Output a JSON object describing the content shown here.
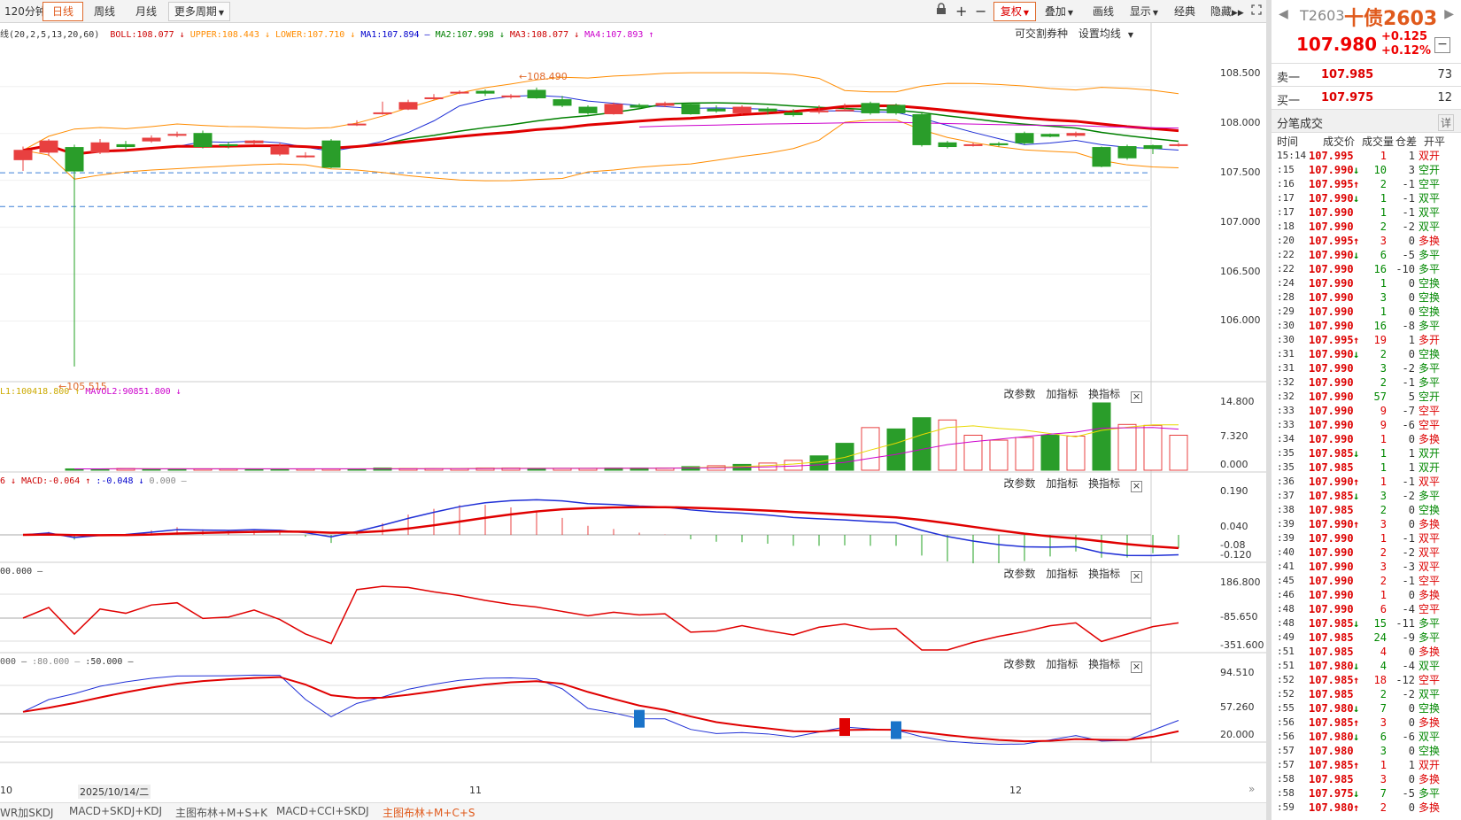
{
  "toolbar": {
    "periods": [
      "120分钟",
      "日线",
      "周线",
      "月线",
      "更多周期"
    ],
    "active_period": "日线",
    "right_buttons": [
      "复权",
      "叠加",
      "画线",
      "显示",
      "经典",
      "隐藏"
    ]
  },
  "legend": {
    "boll": "线(20,2,5,13,20,60)",
    "items": [
      {
        "text": "BOLL:108.077 ↓",
        "color": "#cc0000"
      },
      {
        "text": "UPPER:108.443 ↓",
        "color": "#ff8c00"
      },
      {
        "text": "LOWER:107.710 ↓",
        "color": "#ff8c00"
      },
      {
        "text": "MA1:107.894 —",
        "color": "#0000cc"
      },
      {
        "text": "MA2:107.998 ↓",
        "color": "#008000"
      },
      {
        "text": "MA3:108.077 ↓",
        "color": "#cc0000"
      },
      {
        "text": "MA4:107.893 ↑",
        "color": "#cc00cc"
      }
    ],
    "extra_buttons": [
      "可交割券种",
      "设置均线"
    ]
  },
  "vol_legend": {
    "items": [
      {
        "text": "L1:100418.800 ↑",
        "color": "#ccaa00"
      },
      {
        "text": "MAVOL2:90851.800 ↓",
        "color": "#cc00cc"
      }
    ]
  },
  "macd_legend": {
    "items": [
      {
        "text": "6 ↓",
        "color": "#cc0000"
      },
      {
        "text": "MACD:-0.064 ↑",
        "color": "#cc0000"
      },
      {
        "text": ":-0.048 ↓",
        "color": "#0000cc"
      },
      {
        "text": "0.000 —",
        "color": "#888888"
      }
    ]
  },
  "cci_legend": {
    "items": [
      {
        "text": "00.000 —",
        "color": "#333333"
      }
    ]
  },
  "kdj_legend": {
    "items": [
      {
        "text": "000 —",
        "color": "#555555"
      },
      {
        "text": ":80.000 —",
        "color": "#888888"
      },
      {
        "text": ":50.000 —",
        "color": "#333333"
      }
    ]
  },
  "panel_buttons": [
    "改参数",
    "加指标",
    "换指标"
  ],
  "axes": {
    "price": [
      "108.500",
      "108.000",
      "107.500",
      "107.000",
      "106.500",
      "106.000"
    ],
    "vol": [
      "14.800",
      "7.320",
      "0.000"
    ],
    "macd": [
      "0.190",
      "0.040",
      "-0.08",
      "-0.120"
    ],
    "cci": [
      "186.800",
      "-85.650",
      "-351.600"
    ],
    "kdj": [
      "94.510",
      "57.260",
      "20.000"
    ],
    "dates": [
      {
        "label": "10",
        "x": 0
      },
      {
        "label": "2025/10/14/二",
        "x": 0
      },
      {
        "label": "11",
        "x": 0
      },
      {
        "label": "12",
        "x": 0
      }
    ]
  },
  "annotations": {
    "high": "108.490",
    "low": "105.515"
  },
  "bottom_tabs": [
    "WR加SKDJ",
    "MACD+SKDJ+KDJ",
    "主图布林+M+S+K",
    "MACD+CCI+SKDJ",
    "主图布林+M+C+S"
  ],
  "bottom_active": "主图布林+M+C+S",
  "chart_data": {
    "type": "candlestick",
    "candles": [
      [
        107.72,
        107.82,
        107.86,
        107.6
      ],
      [
        107.8,
        107.92,
        107.94,
        107.76
      ],
      [
        107.85,
        107.6,
        107.88,
        105.515
      ],
      [
        107.8,
        107.9,
        107.94,
        107.78
      ],
      [
        107.88,
        107.86,
        107.92,
        107.82
      ],
      [
        107.92,
        107.95,
        107.98,
        107.9
      ],
      [
        107.98,
        107.99,
        108.02,
        107.96
      ],
      [
        108.0,
        107.86,
        108.03,
        107.84
      ],
      [
        107.88,
        107.87,
        107.91,
        107.84
      ],
      [
        107.9,
        107.92,
        107.93,
        107.88
      ],
      [
        107.78,
        107.86,
        107.9,
        107.76
      ],
      [
        107.76,
        107.76,
        107.8,
        107.74
      ],
      [
        107.92,
        107.64,
        107.94,
        107.63
      ],
      [
        108.1,
        108.1,
        108.14,
        108.08
      ],
      [
        108.22,
        108.22,
        108.34,
        108.2
      ],
      [
        108.26,
        108.33,
        108.36,
        108.25
      ],
      [
        108.38,
        108.38,
        108.42,
        108.36
      ],
      [
        108.44,
        108.44,
        108.46,
        108.42
      ],
      [
        108.45,
        108.43,
        108.47,
        108.4
      ],
      [
        108.39,
        108.4,
        108.42,
        108.37
      ],
      [
        108.46,
        108.38,
        108.49,
        108.37
      ],
      [
        108.36,
        108.3,
        108.4,
        108.28
      ],
      [
        108.28,
        108.22,
        108.3,
        108.2
      ],
      [
        108.21,
        108.31,
        108.33,
        108.2
      ],
      [
        108.3,
        108.28,
        108.32,
        108.26
      ],
      [
        108.3,
        108.32,
        108.34,
        108.28
      ],
      [
        108.31,
        108.21,
        108.33,
        108.2
      ],
      [
        108.26,
        108.24,
        108.3,
        108.22
      ],
      [
        108.22,
        108.28,
        108.3,
        108.2
      ],
      [
        108.26,
        108.24,
        108.28,
        108.2
      ],
      [
        108.22,
        108.2,
        108.26,
        108.18
      ],
      [
        108.24,
        108.24,
        108.3,
        108.21
      ],
      [
        108.25,
        108.25,
        108.32,
        108.24
      ],
      [
        108.32,
        108.22,
        108.34,
        108.2
      ],
      [
        108.3,
        108.22,
        108.32,
        108.2
      ],
      [
        108.2,
        107.88,
        108.22,
        107.86
      ],
      [
        107.9,
        107.86,
        107.92,
        107.84
      ],
      [
        107.88,
        107.88,
        107.9,
        107.86
      ],
      [
        107.89,
        107.88,
        107.91,
        107.86
      ],
      [
        108.0,
        107.9,
        108.02,
        107.88
      ],
      [
        107.99,
        107.97,
        108.0,
        107.96
      ],
      [
        107.98,
        108.0,
        108.02,
        107.96
      ],
      [
        107.85,
        107.65,
        107.86,
        107.64
      ],
      [
        107.86,
        107.74,
        107.88,
        107.72
      ],
      [
        107.87,
        107.84,
        107.88,
        107.78
      ],
      [
        107.88,
        107.88,
        107.9,
        107.86
      ]
    ],
    "volume": [
      0.3,
      0.3,
      0.4,
      0.3,
      0.3,
      0.3,
      0.3,
      0.3,
      0.3,
      0.3,
      0.3,
      0.3,
      0.5,
      0.4,
      0.4,
      0.4,
      0.5,
      0.5,
      0.4,
      0.4,
      0.4,
      0.5,
      0.5,
      0.5,
      0.8,
      1.0,
      1.3,
      1.6,
      2.2,
      3.2,
      6.0,
      9.5,
      9.2,
      11.7,
      11.2,
      7.8,
      6.7,
      7.3,
      7.8,
      7.6,
      15.0,
      10.2,
      10.0,
      7.8
    ],
    "vol_colors": [
      "g",
      "g",
      "r",
      "g",
      "g",
      "r",
      "r",
      "g",
      "g",
      "r",
      "r",
      "g",
      "g",
      "r",
      "r",
      "r",
      "r",
      "r",
      "g",
      "r",
      "r",
      "g",
      "g",
      "r",
      "g",
      "r",
      "g",
      "r",
      "r",
      "g",
      "g",
      "r",
      "g",
      "g",
      "r",
      "r",
      "r",
      "r",
      "g",
      "r",
      "g",
      "r",
      "r",
      "r"
    ],
    "ylim_price": [
      105.4,
      108.8
    ],
    "ylim_vol": [
      0,
      14.8
    ]
  },
  "quote": {
    "code": "T2603",
    "name": "十债2603",
    "last": "107.980",
    "change": "+0.125",
    "pct": "+0.12%",
    "ask": {
      "label": "卖一",
      "price": "107.985",
      "qty": "73"
    },
    "bid": {
      "label": "买一",
      "price": "107.975",
      "qty": "12"
    }
  },
  "ticks": {
    "title": "分笔成交",
    "detail": "详",
    "columns": [
      "时间",
      "成交价",
      "成交量",
      "仓差",
      "开平"
    ],
    "rows": [
      [
        "15:14",
        "107.995",
        "",
        "1",
        "1",
        "双开",
        "r"
      ],
      [
        ":15",
        "107.990",
        "↓",
        "10",
        "3",
        "空开",
        "g"
      ],
      [
        ":16",
        "107.995",
        "↑",
        "2",
        "-1",
        "空平",
        "g"
      ],
      [
        ":17",
        "107.990",
        "↓",
        "1",
        "-1",
        "双平",
        "g"
      ],
      [
        ":17",
        "107.990",
        "",
        "1",
        "-1",
        "双平",
        "g"
      ],
      [
        ":18",
        "107.990",
        "",
        "2",
        "-2",
        "双平",
        "g"
      ],
      [
        ":20",
        "107.995",
        "↑",
        "3",
        "0",
        "多换",
        "r"
      ],
      [
        ":22",
        "107.990",
        "↓",
        "6",
        "-5",
        "多平",
        "g"
      ],
      [
        ":22",
        "107.990",
        "",
        "16",
        "-10",
        "多平",
        "g"
      ],
      [
        ":24",
        "107.990",
        "",
        "1",
        "0",
        "空换",
        "g"
      ],
      [
        ":28",
        "107.990",
        "",
        "3",
        "0",
        "空换",
        "g"
      ],
      [
        ":29",
        "107.990",
        "",
        "1",
        "0",
        "空换",
        "g"
      ],
      [
        ":30",
        "107.990",
        "",
        "16",
        "-8",
        "多平",
        "g"
      ],
      [
        ":30",
        "107.995",
        "↑",
        "19",
        "1",
        "多开",
        "r"
      ],
      [
        ":31",
        "107.990",
        "↓",
        "2",
        "0",
        "空换",
        "g"
      ],
      [
        ":31",
        "107.990",
        "",
        "3",
        "-2",
        "多平",
        "g"
      ],
      [
        ":32",
        "107.990",
        "",
        "2",
        "-1",
        "多平",
        "g"
      ],
      [
        ":32",
        "107.990",
        "",
        "57",
        "5",
        "空开",
        "g"
      ],
      [
        ":33",
        "107.990",
        "",
        "9",
        "-7",
        "空平",
        "r"
      ],
      [
        ":33",
        "107.990",
        "",
        "9",
        "-6",
        "空平",
        "r"
      ],
      [
        ":34",
        "107.990",
        "",
        "1",
        "0",
        "多换",
        "r"
      ],
      [
        ":35",
        "107.985",
        "↓",
        "1",
        "1",
        "双开",
        "g"
      ],
      [
        ":35",
        "107.985",
        "",
        "1",
        "1",
        "双开",
        "g"
      ],
      [
        ":36",
        "107.990",
        "↑",
        "1",
        "-1",
        "双平",
        "r"
      ],
      [
        ":37",
        "107.985",
        "↓",
        "3",
        "-2",
        "多平",
        "g"
      ],
      [
        ":38",
        "107.985",
        "",
        "2",
        "0",
        "空换",
        "g"
      ],
      [
        ":39",
        "107.990",
        "↑",
        "3",
        "0",
        "多换",
        "r"
      ],
      [
        ":39",
        "107.990",
        "",
        "1",
        "-1",
        "双平",
        "r"
      ],
      [
        ":40",
        "107.990",
        "",
        "2",
        "-2",
        "双平",
        "r"
      ],
      [
        ":41",
        "107.990",
        "",
        "3",
        "-3",
        "双平",
        "r"
      ],
      [
        ":45",
        "107.990",
        "",
        "2",
        "-1",
        "空平",
        "r"
      ],
      [
        ":46",
        "107.990",
        "",
        "1",
        "0",
        "多换",
        "r"
      ],
      [
        ":48",
        "107.990",
        "",
        "6",
        "-4",
        "空平",
        "r"
      ],
      [
        ":48",
        "107.985",
        "↓",
        "15",
        "-11",
        "多平",
        "g"
      ],
      [
        ":49",
        "107.985",
        "",
        "24",
        "-9",
        "多平",
        "g"
      ],
      [
        ":51",
        "107.985",
        "",
        "4",
        "0",
        "多换",
        "r"
      ],
      [
        ":51",
        "107.980",
        "↓",
        "4",
        "-4",
        "双平",
        "g"
      ],
      [
        ":52",
        "107.985",
        "↑",
        "18",
        "-12",
        "空平",
        "r"
      ],
      [
        ":52",
        "107.985",
        "",
        "2",
        "-2",
        "双平",
        "g"
      ],
      [
        ":55",
        "107.980",
        "↓",
        "7",
        "0",
        "空换",
        "g"
      ],
      [
        ":56",
        "107.985",
        "↑",
        "3",
        "0",
        "多换",
        "r"
      ],
      [
        ":56",
        "107.980",
        "↓",
        "6",
        "-6",
        "双平",
        "g"
      ],
      [
        ":57",
        "107.980",
        "",
        "3",
        "0",
        "空换",
        "g"
      ],
      [
        ":57",
        "107.985",
        "↑",
        "1",
        "1",
        "双开",
        "r"
      ],
      [
        ":58",
        "107.985",
        "",
        "3",
        "0",
        "多换",
        "r"
      ],
      [
        ":58",
        "107.975",
        "↓",
        "7",
        "-5",
        "多平",
        "g"
      ],
      [
        ":59",
        "107.980",
        "↑",
        "2",
        "0",
        "多换",
        "r"
      ]
    ]
  }
}
